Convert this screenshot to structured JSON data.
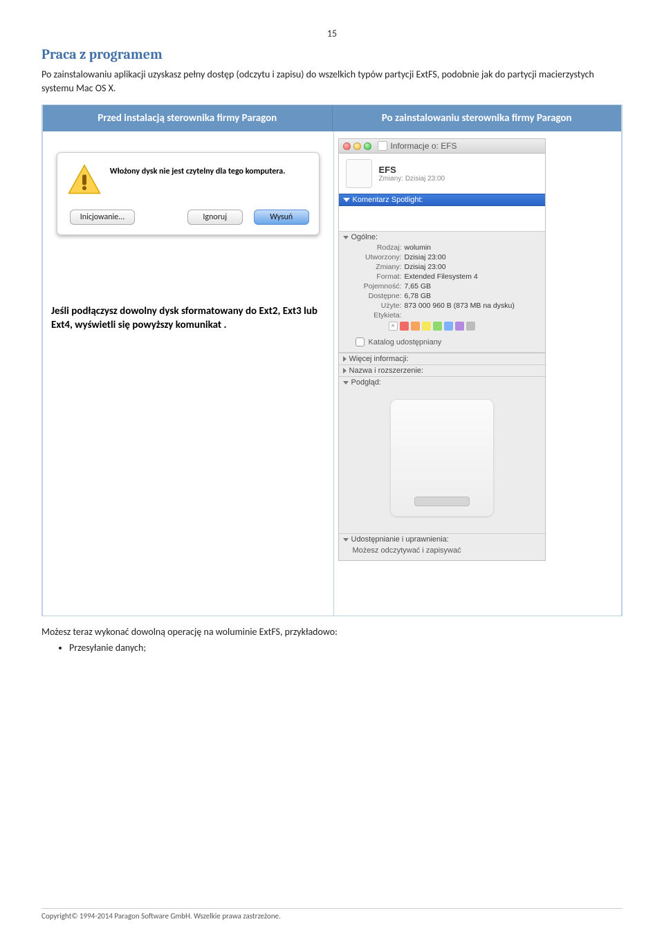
{
  "page_number": "15",
  "section_heading": "Praca z programem",
  "intro_text": "Po zainstalowaniu aplikacji uzyskasz pełny dostęp (odczytu i zapisu) do wszelkich typów partycji ExtFS, podobnie jak do partycji macierzystych systemu Mac OS X.",
  "table": {
    "header_left": "Przed instalacją sterownika firmy Paragon",
    "header_right": "Po zainstalowaniu sterownika firmy Paragon"
  },
  "dialog": {
    "message": "Włożony dysk nie jest czytelny dla tego komputera.",
    "buttons": {
      "init": "Inicjowanie...",
      "ignore": "Ignoruj",
      "eject": "Wysuń"
    }
  },
  "left_caption": "Jeśli podłączysz dowolny dysk sformatowany do Ext2, Ext3 lub Ext4, wyświetli się powyższy komunikat .",
  "info": {
    "window_title": "Informacje o: EFS",
    "vol_name": "EFS",
    "vol_changes": "Zmiany:  Dzisiaj 23:00",
    "spotlight": "Komentarz Spotlight:",
    "sections": {
      "general": "Ogólne:",
      "more": "Więcej informacji:",
      "name_ext": "Nazwa i rozszerzenie:",
      "preview": "Podgląd:",
      "sharing": "Udostępnianie i uprawnienia:"
    },
    "general_rows": {
      "kind_k": "Rodzaj:",
      "kind_v": "wolumin",
      "created_k": "Utworzony:",
      "created_v": "Dzisiaj 23:00",
      "modified_k": "Zmiany:",
      "modified_v": "Dzisiaj 23:00",
      "format_k": "Format:",
      "format_v": "Extended Filesystem 4",
      "capacity_k": "Pojemność:",
      "capacity_v": "7,65 GB",
      "available_k": "Dostępne:",
      "available_v": "6,78 GB",
      "used_k": "Użyte:",
      "used_v": "873 000 960 B (873 MB na dysku)",
      "label_k": "Etykieta:"
    },
    "shared_folder": "Katalog udostępniany",
    "permissions_text": "Możesz odczytywać i zapisywać"
  },
  "after_text": "Możesz teraz wykonać dowolną operację na woluminie ExtFS, przykładowo:",
  "bullets": [
    "Przesyłanie danych;"
  ],
  "footer": "Copyright© 1994-2014 Paragon Software GmbH. Wszelkie prawa zastrzeżone."
}
